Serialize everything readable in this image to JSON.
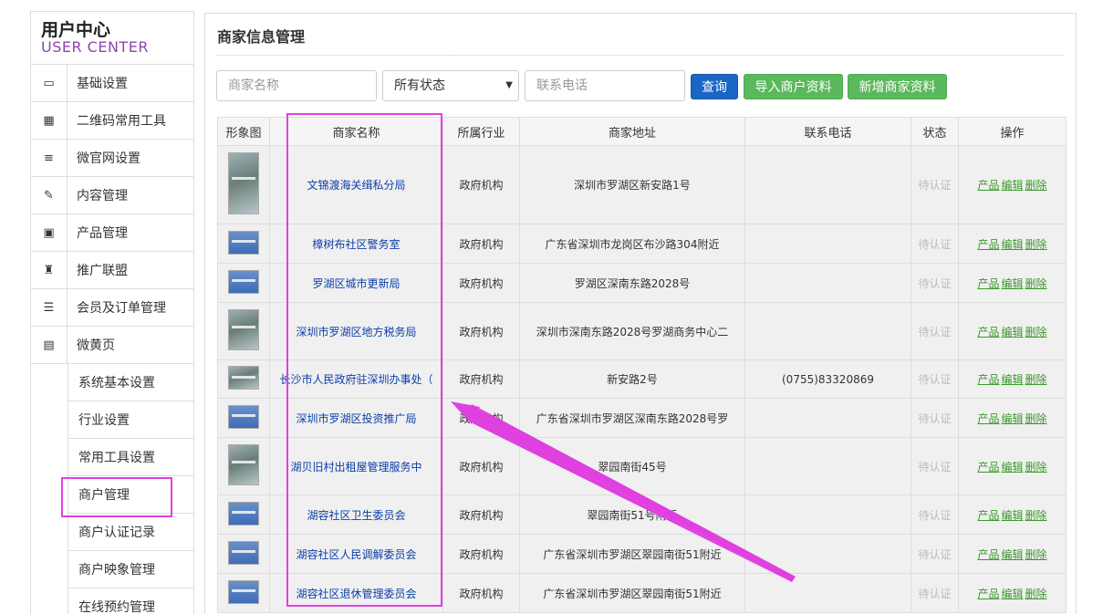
{
  "sidebar": {
    "title_cn": "用户中心",
    "title_en": "USER CENTER",
    "items": [
      {
        "label": "基础设置",
        "icon": "monitor-icon"
      },
      {
        "label": "二维码常用工具",
        "icon": "qrcode-icon"
      },
      {
        "label": "微官网设置",
        "icon": "list-icon"
      },
      {
        "label": "内容管理",
        "icon": "edit-icon"
      },
      {
        "label": "产品管理",
        "icon": "picture-icon"
      },
      {
        "label": "推广联盟",
        "icon": "gift-icon"
      },
      {
        "label": "会员及订单管理",
        "icon": "database-icon"
      },
      {
        "label": "微黄页",
        "icon": "book-icon"
      }
    ],
    "sub_items": [
      {
        "label": "系统基本设置"
      },
      {
        "label": "行业设置"
      },
      {
        "label": "常用工具设置"
      },
      {
        "label": "商户管理",
        "highlighted": true
      },
      {
        "label": "商户认证记录"
      },
      {
        "label": "商户映象管理"
      },
      {
        "label": "在线预约管理"
      }
    ]
  },
  "main": {
    "title": "商家信息管理",
    "search": {
      "name_placeholder": "商家名称",
      "status_value": "所有状态",
      "phone_placeholder": "联系电话",
      "query_label": "查询",
      "import_label": "导入商户资料",
      "add_label": "新增商家资料"
    },
    "table": {
      "headers": [
        "形象图",
        "商家名称",
        "所属行业",
        "商家地址",
        "联系电话",
        "状态",
        "操作"
      ],
      "rows": [
        {
          "name": "文锦渡海关缉私分局",
          "industry": "政府机构",
          "address": "深圳市罗湖区新安路1号",
          "phone": "",
          "status": "待认证",
          "thumb": "photo"
        },
        {
          "name": "樟树布社区警务室",
          "industry": "政府机构",
          "address": "广东省深圳市龙岗区布沙路304附近",
          "phone": "",
          "status": "待认证",
          "thumb": "sign"
        },
        {
          "name": "罗湖区城市更新局",
          "industry": "政府机构",
          "address": "罗湖区深南东路2028号",
          "phone": "",
          "status": "待认证",
          "thumb": "sign"
        },
        {
          "name": "深圳市罗湖区地方税务局",
          "industry": "政府机构",
          "address": "深圳市深南东路2028号罗湖商务中心二",
          "phone": "",
          "status": "待认证",
          "thumb": "photo"
        },
        {
          "name": "长沙市人民政府驻深圳办事处（",
          "industry": "政府机构",
          "address": "新安路2号",
          "phone": "(0755)83320869",
          "status": "待认证",
          "thumb": "photo"
        },
        {
          "name": "深圳市罗湖区投资推广局",
          "industry": "政府机构",
          "address": "广东省深圳市罗湖区深南东路2028号罗",
          "phone": "",
          "status": "待认证",
          "thumb": "sign"
        },
        {
          "name": "湖贝旧村出租屋管理服务中",
          "industry": "政府机构",
          "address": "翠园南街45号",
          "phone": "",
          "status": "待认证",
          "thumb": "photo"
        },
        {
          "name": "湖容社区卫生委员会",
          "industry": "政府机构",
          "address": "翠园南街51号附近",
          "phone": "",
          "status": "待认证",
          "thumb": "sign"
        },
        {
          "name": "湖容社区人民调解委员会",
          "industry": "政府机构",
          "address": "广东省深圳市罗湖区翠园南街51附近",
          "phone": "",
          "status": "待认证",
          "thumb": "sign"
        },
        {
          "name": "湖容社区退休管理委员会",
          "industry": "政府机构",
          "address": "广东省深圳市罗湖区翠园南街51附近",
          "phone": "",
          "status": "待认证",
          "thumb": "sign"
        }
      ],
      "ops": [
        "产品",
        "编辑",
        "删除"
      ]
    }
  },
  "colors": {
    "highlight": "#e040e0",
    "link_blue": "#0b3ea8",
    "ops_green": "#3a9a2a",
    "query_blue": "#1a66c4",
    "btn_green": "#5cb85c"
  }
}
